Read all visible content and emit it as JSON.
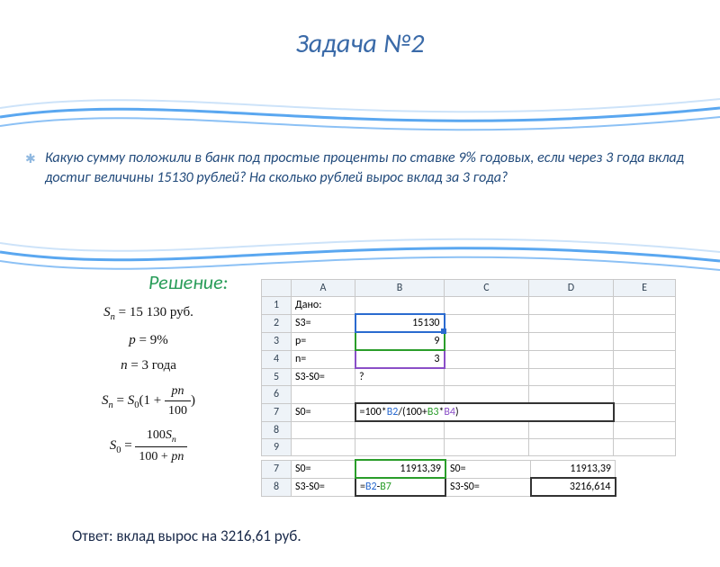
{
  "title": "Задача №2",
  "problem_text": "Какую сумму положили в банк под простые проценты по ставке 9% годовых, если через 3 года вклад достиг величины 15130 рублей? На сколько рублей вырос вклад за 3 года?",
  "solution_label": "Решение:",
  "math": {
    "Sn": "15 130 руб.",
    "p": "9%",
    "n": "3 года"
  },
  "grid1": {
    "headers": [
      "",
      "A",
      "B",
      "C",
      "D",
      "E"
    ],
    "rows": [
      {
        "n": "1",
        "A": "Дано:",
        "B": "",
        "C": "",
        "D": "",
        "E": ""
      },
      {
        "n": "2",
        "A": "S3=",
        "B": "15130",
        "C": "",
        "D": "",
        "E": ""
      },
      {
        "n": "3",
        "A": "p=",
        "B": "9",
        "C": "",
        "D": "",
        "E": ""
      },
      {
        "n": "4",
        "A": "n=",
        "B": "3",
        "C": "",
        "D": "",
        "E": ""
      },
      {
        "n": "5",
        "A": "S3-S0=",
        "B": "?",
        "C": "",
        "D": "",
        "E": ""
      },
      {
        "n": "6",
        "A": "",
        "B": "",
        "C": "",
        "D": "",
        "E": ""
      },
      {
        "n": "7",
        "A": "S0=",
        "B_formula": "=100*B2/(100+B3*B4)",
        "C": "",
        "D": "",
        "E": ""
      },
      {
        "n": "8",
        "A": "",
        "B": "",
        "C": "",
        "D": "",
        "E": ""
      },
      {
        "n": "9",
        "A": "",
        "B": "",
        "C": "",
        "D": "",
        "E": ""
      }
    ]
  },
  "grid2": {
    "rows": [
      {
        "n": "7",
        "A": "S0=",
        "B": "11913,39",
        "C": "S0=",
        "D": "11913,39"
      },
      {
        "n": "8",
        "A": "S3-S0=",
        "B_formula": "=B2-B7",
        "C": "S3-S0=",
        "D": "3216,614"
      }
    ]
  },
  "answer": "Ответ: вклад вырос на 3216,61 руб."
}
